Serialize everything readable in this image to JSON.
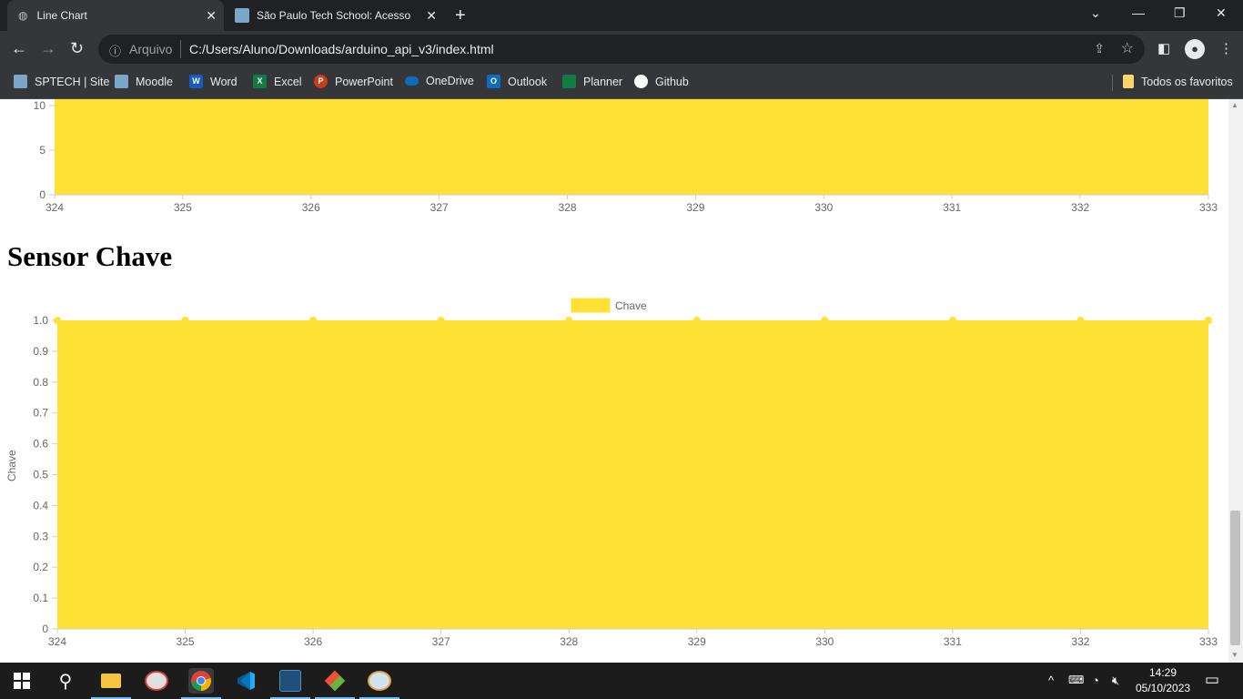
{
  "browser": {
    "tabs": [
      {
        "title": "Line Chart",
        "active": true
      },
      {
        "title": "São Paulo Tech School: Acesso a",
        "active": false
      }
    ],
    "new_tab": "+",
    "window_controls": {
      "menu": "⌄",
      "minimize": "—",
      "restore": "❐",
      "close": "✕"
    },
    "address": {
      "scheme_label": "Arquivo",
      "url": "C:/Users/Aluno/Downloads/arduino_api_v3/index.html"
    },
    "bookmarks": [
      {
        "label": "SPTECH | Site",
        "icon": "sptech-icon",
        "color": "#7aa7c7"
      },
      {
        "label": "Moodle",
        "icon": "moodle-icon",
        "color": "#7aa7c7"
      },
      {
        "label": "Word",
        "icon": "word-icon",
        "color": "#185abd"
      },
      {
        "label": "Excel",
        "icon": "excel-icon",
        "color": "#107c41"
      },
      {
        "label": "PowerPoint",
        "icon": "powerpoint-icon",
        "color": "#c43e1c"
      },
      {
        "label": "OneDrive",
        "icon": "onedrive-icon",
        "color": "#0f6cbd"
      },
      {
        "label": "Outlook",
        "icon": "outlook-icon",
        "color": "#0f6cbd"
      },
      {
        "label": "Planner",
        "icon": "planner-icon",
        "color": "#107c41"
      },
      {
        "label": "Github",
        "icon": "github-icon",
        "color": "#ffffff"
      }
    ],
    "favorites_label": "Todos os favoritos"
  },
  "page": {
    "section_title": "Sensor Chave"
  },
  "chart_data": [
    {
      "type": "area",
      "categories": [
        "324",
        "325",
        "326",
        "327",
        "328",
        "329",
        "330",
        "331",
        "332",
        "333"
      ],
      "y_ticks_visible": [
        "0",
        "5",
        "10"
      ],
      "fill_color": "#ffe135",
      "note_visible": "top portion cropped by scroll"
    },
    {
      "type": "area",
      "legend": [
        "Chave"
      ],
      "legend_position": "top-center",
      "ylabel": "Chave",
      "ylim": [
        0,
        1.0
      ],
      "y_ticks": [
        "0",
        "0.1",
        "0.2",
        "0.3",
        "0.4",
        "0.5",
        "0.6",
        "0.7",
        "0.8",
        "0.9",
        "1.0"
      ],
      "categories": [
        "324",
        "325",
        "326",
        "327",
        "328",
        "329",
        "330",
        "331",
        "332",
        "333"
      ],
      "series": [
        {
          "name": "Chave",
          "values": [
            1,
            1,
            1,
            1,
            1,
            1,
            1,
            1,
            1,
            1
          ]
        }
      ],
      "fill_color": "#ffe135"
    }
  ],
  "taskbar": {
    "apps": [
      "start-icon",
      "search-icon",
      "file-explorer-icon",
      "paint-icon",
      "chrome-icon",
      "vscode-icon",
      "mysql-workbench-icon",
      "git-icon",
      "paint-3d-icon"
    ],
    "tray": {
      "chevron": "^",
      "time": "14:29",
      "date": "05/10/2023"
    }
  }
}
